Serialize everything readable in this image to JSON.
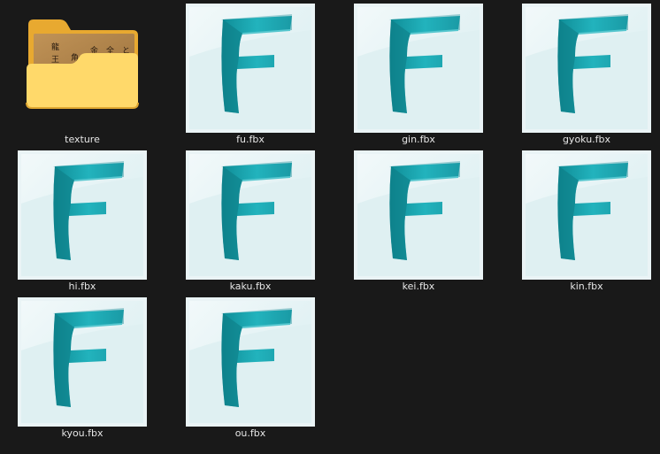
{
  "window": {
    "view": "large-icons",
    "background_color": "#191919"
  },
  "files": [
    {
      "name": "texture",
      "type": "folder",
      "icon": "folder-icon"
    },
    {
      "name": "fu.fbx",
      "type": "fbx",
      "icon": "fbx-file-icon"
    },
    {
      "name": "gin.fbx",
      "type": "fbx",
      "icon": "fbx-file-icon"
    },
    {
      "name": "gyoku.fbx",
      "type": "fbx",
      "icon": "fbx-file-icon"
    },
    {
      "name": "hi.fbx",
      "type": "fbx",
      "icon": "fbx-file-icon"
    },
    {
      "name": "kaku.fbx",
      "type": "fbx",
      "icon": "fbx-file-icon"
    },
    {
      "name": "kei.fbx",
      "type": "fbx",
      "icon": "fbx-file-icon"
    },
    {
      "name": "kin.fbx",
      "type": "fbx",
      "icon": "fbx-file-icon"
    },
    {
      "name": "kyou.fbx",
      "type": "fbx",
      "icon": "fbx-file-icon"
    },
    {
      "name": "ou.fbx",
      "type": "fbx",
      "icon": "fbx-file-icon"
    }
  ],
  "colors": {
    "fbx_background": "#eaf4f6",
    "fbx_logo_teal": "#1aa3ad",
    "fbx_logo_dark": "#0e7f89",
    "folder_yellow": "#f8c24a",
    "folder_front": "#ffd96a",
    "label_text": "#e6e6e6"
  }
}
